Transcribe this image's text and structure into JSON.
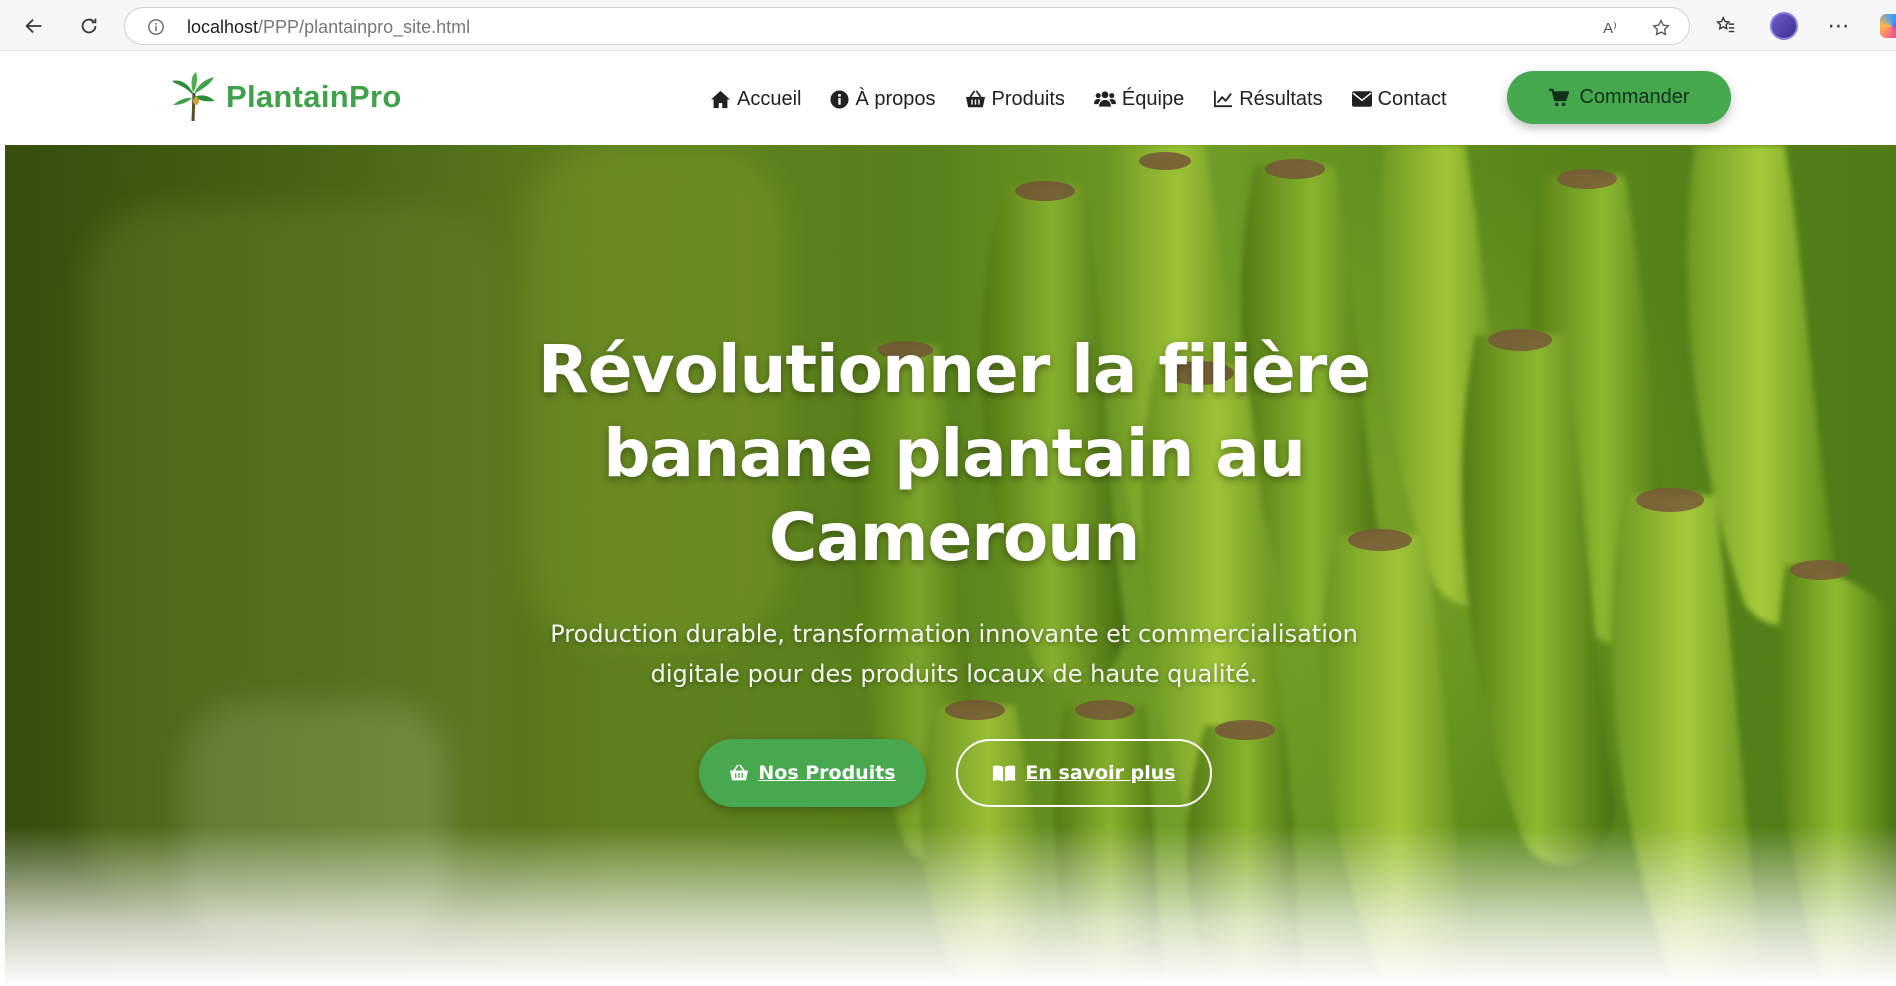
{
  "browser": {
    "url_host": "localhost",
    "url_path": "/PPP/plantainpro_site.html",
    "read_aloud_label": "A⁾"
  },
  "site": {
    "brand": "PlantainPro",
    "brand_color": "#3fa24a",
    "nav": [
      {
        "label": "Accueil",
        "icon": "home-icon"
      },
      {
        "label": "À propos",
        "icon": "info-circle-icon"
      },
      {
        "label": "Produits",
        "icon": "basket-icon"
      },
      {
        "label": "Équipe",
        "icon": "users-icon"
      },
      {
        "label": "Résultats",
        "icon": "chart-line-icon"
      },
      {
        "label": "Contact",
        "icon": "envelope-icon"
      }
    ],
    "order_button": {
      "label": "Commander",
      "icon": "cart-icon"
    }
  },
  "hero": {
    "title_line1": "Révolutionner la filière",
    "title_line2": "banane plantain au",
    "title_line3": "Cameroun",
    "subtitle_line1": "Production durable, transformation innovante et commercialisation",
    "subtitle_line2": "digitale pour des produits locaux de haute qualité.",
    "primary_button": {
      "label": "Nos Produits",
      "icon": "basket-icon"
    },
    "secondary_button": {
      "label": "En savoir plus",
      "icon": "book-open-icon"
    },
    "accent_color": "#47a84f"
  }
}
